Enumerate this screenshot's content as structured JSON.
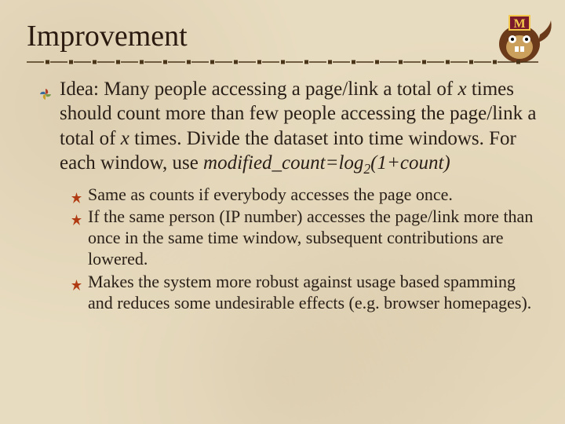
{
  "title": "Improvement",
  "main": {
    "pre": "Idea: Many people accessing a page/link a total of ",
    "x1": "x",
    "mid1": " times should count more than few people accessing the page/link a total of ",
    "x2": "x",
    "mid2": " times. Divide the dataset into time windows. For each window, use ",
    "formula_left": "modified_count=log",
    "formula_sub": "2",
    "formula_right": "(1+count)"
  },
  "subs": [
    "Same as counts if everybody accesses the page once.",
    "If the same person (IP number) accesses the page/link more than once in the same time window, subsequent contributions are lowered.",
    "Makes the system more robust against usage based spamming and reduces some undesirable effects (e.g. browser homepages)."
  ]
}
